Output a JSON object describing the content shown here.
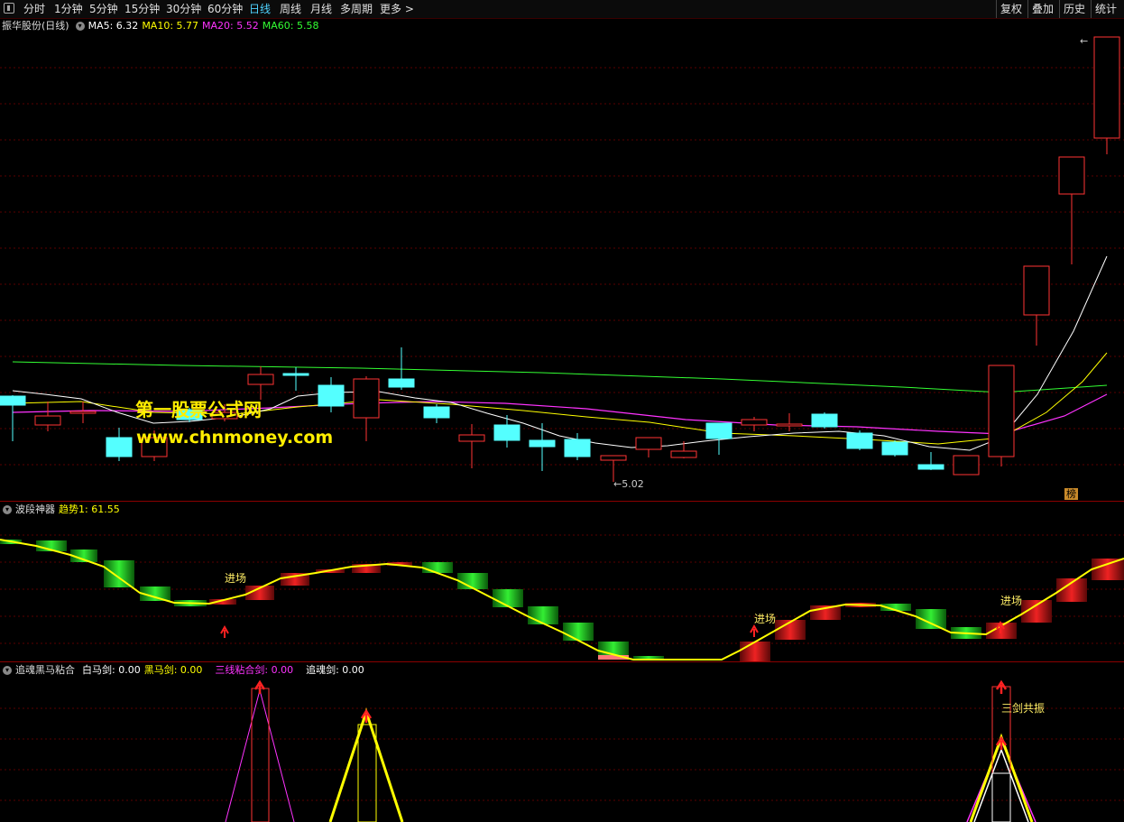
{
  "toolbar": {
    "periods": [
      "分时",
      "1分钟",
      "5分钟",
      "15分钟",
      "30分钟",
      "60分钟",
      "日线",
      "周线",
      "月线",
      "多周期",
      "更多 >"
    ],
    "active_period": "日线",
    "right_buttons": [
      "复权",
      "叠加",
      "历史",
      "统计"
    ]
  },
  "main_panel": {
    "title": "振华股份(日线)",
    "ma": [
      {
        "label": "MA5: 6.32",
        "color": "#ffffff"
      },
      {
        "label": "MA10: 5.77",
        "color": "#ffff00"
      },
      {
        "label": "MA20: 5.52",
        "color": "#ff33ff"
      },
      {
        "label": "MA60: 5.58",
        "color": "#33ff33"
      }
    ],
    "low_marker": "←5.02",
    "watermark_cn": "第一股票公式网",
    "watermark_url": "www.chnmoney.com",
    "badge": "榜"
  },
  "wave_panel": {
    "title": "波段神器",
    "value_label": "趋势1: 61.55",
    "entry_labels": [
      "进场",
      "进场",
      "进场"
    ]
  },
  "sword_panel": {
    "title": "追魂黑马粘合",
    "labels": [
      {
        "text": "白马剑: 0.00",
        "color": "#ffffff"
      },
      {
        "text": "黑马剑: 0.00",
        "color": "#ffff00"
      },
      {
        "text": "三线粘合剑: 0.00",
        "color": "#ff33ff"
      },
      {
        "text": "追魂剑: 0.00",
        "color": "#ffffff"
      }
    ],
    "resonance_label": "三剑共振"
  },
  "colors": {
    "up": "#ff3333",
    "down": "#54ffff",
    "ma5": "#ffffff",
    "ma10": "#ffff00",
    "ma20": "#ff33ff",
    "ma60": "#33ff33",
    "grid": "#5a0000"
  }
}
